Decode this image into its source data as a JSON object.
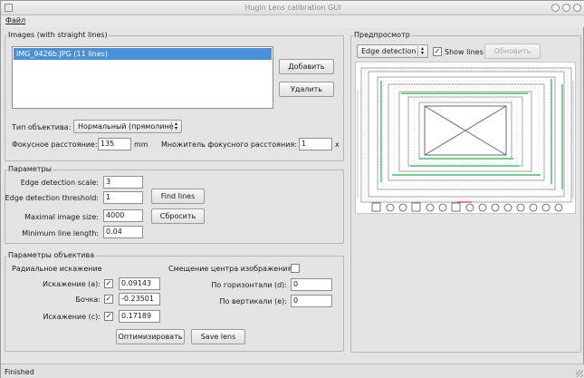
{
  "window": {
    "title": "Hugin Lens calibration GUI"
  },
  "menu": {
    "file": "Файл"
  },
  "images": {
    "group_title": "Images (with straight lines)",
    "list_items": [
      "IMG_9426b.JPG (11 lines)"
    ],
    "add_button": "Добавить",
    "remove_button": "Удалить",
    "lens_type_label": "Тип объектива:",
    "lens_type_value": "Нормальный (прямолине",
    "focal_length_label": "Фокусное расстояние:",
    "focal_length_value": "135",
    "focal_length_unit": "mm",
    "multiplier_label": "Множитель фокусного расстояния:",
    "multiplier_value": "1",
    "multiplier_unit": "x"
  },
  "params": {
    "group_title": "Параметры",
    "edge_scale_label": "Edge detection scale:",
    "edge_scale_value": "3",
    "edge_threshold_label": "Edge detection threshold:",
    "edge_threshold_value": "1",
    "max_size_label": "Maximal image size:",
    "max_size_value": "4000",
    "min_line_label": "Minimum line length:",
    "min_line_value": "0.04",
    "find_lines_button": "Find lines",
    "reset_button": "Сбросить"
  },
  "lens_params": {
    "group_title": "Параметры объектива",
    "radial_title": "Радиальное искажение",
    "a_label": "Искажение (a):",
    "a_checked": true,
    "a_value": "0.09143",
    "b_label": "Бочка:",
    "b_checked": true,
    "b_value": "-0.23501",
    "c_label": "Искажение (c):",
    "c_checked": true,
    "c_value": "0.17189",
    "shift_label": "Смещение центра изображения",
    "shift_checked": false,
    "d_label": "По горизонтали (d):",
    "d_value": "0",
    "e_label": "По вертикали (e):",
    "e_value": "0",
    "optimize_button": "Оптимизировать",
    "save_button": "Save lens"
  },
  "preview": {
    "group_title": "Предпросмотр",
    "mode_value": "Edge detection",
    "show_lines_label": "Show lines",
    "show_lines_checked": true,
    "refresh_button": "Обновить"
  },
  "status": {
    "text": "Finished"
  },
  "colors": {
    "selection": "#4a90d9",
    "line_green": "#22b14c",
    "line_red": "#e03030"
  }
}
